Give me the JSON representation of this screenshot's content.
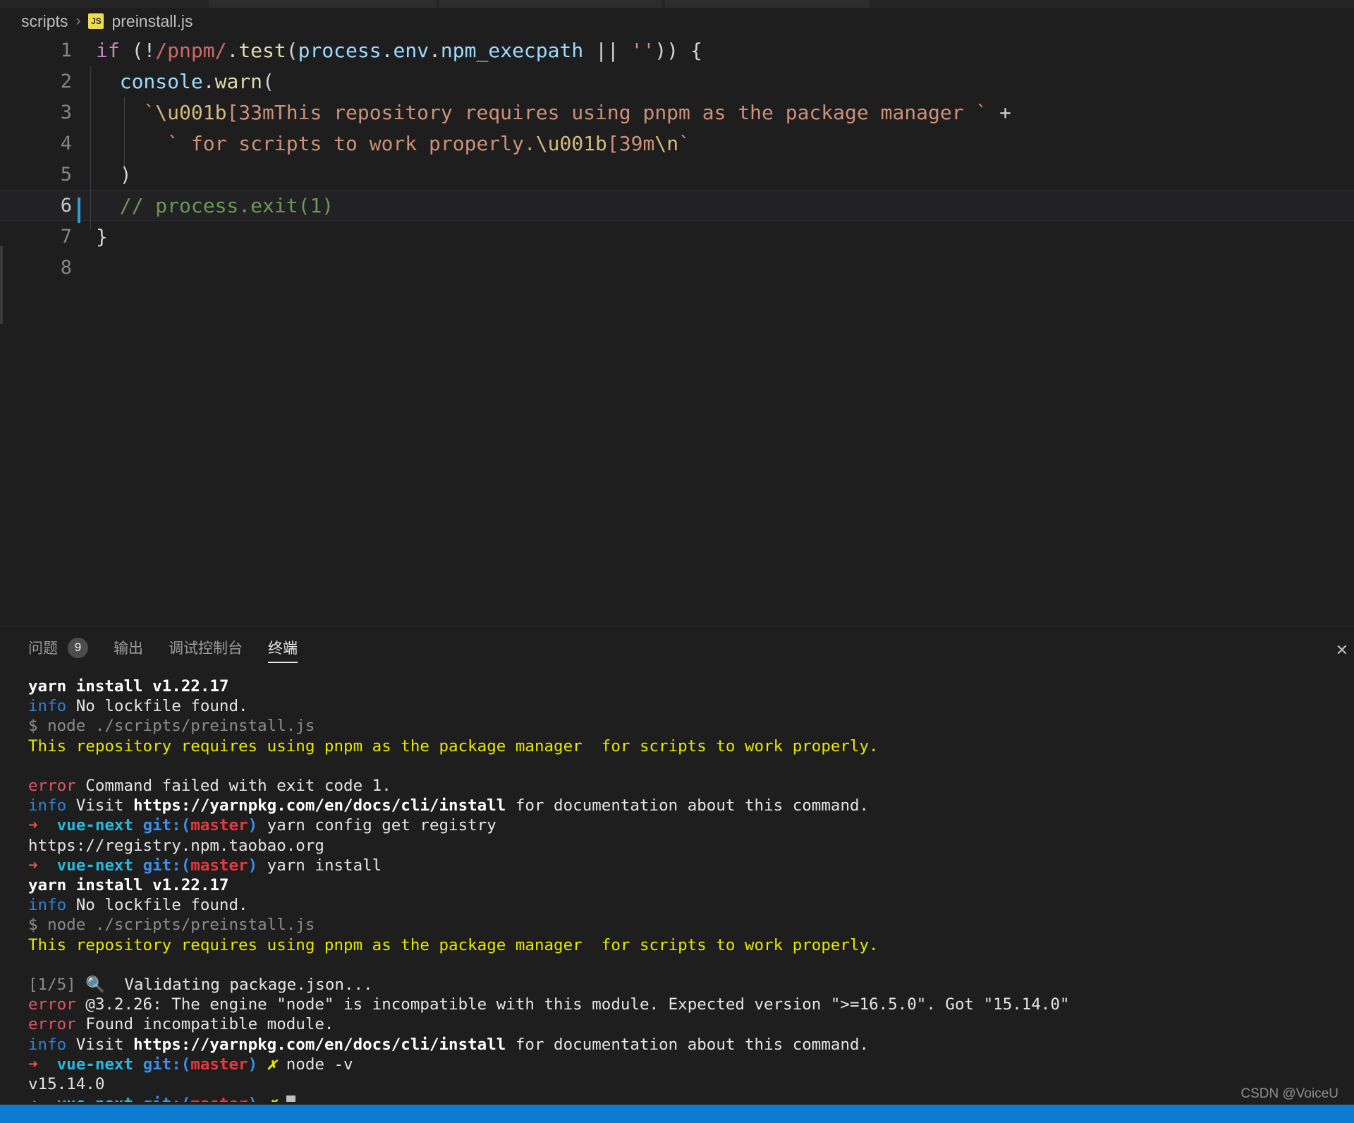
{
  "breadcrumb": {
    "folder": "scripts",
    "separator": "›",
    "file_icon": "JS",
    "file": "preinstall.js"
  },
  "editor": {
    "lines": [
      {
        "num": "1",
        "tokens": [
          {
            "t": "kw",
            "v": "if"
          },
          {
            "t": "op",
            "v": " ("
          },
          {
            "t": "op",
            "v": "!"
          },
          {
            "t": "re",
            "v": "/pnpm/"
          },
          {
            "t": "punc",
            "v": "."
          },
          {
            "t": "fn",
            "v": "test"
          },
          {
            "t": "punc",
            "v": "("
          },
          {
            "t": "var",
            "v": "process"
          },
          {
            "t": "punc",
            "v": "."
          },
          {
            "t": "var",
            "v": "env"
          },
          {
            "t": "punc",
            "v": "."
          },
          {
            "t": "var",
            "v": "npm_execpath"
          },
          {
            "t": "op",
            "v": " || "
          },
          {
            "t": "str",
            "v": "''"
          },
          {
            "t": "punc",
            "v": ")) {"
          }
        ]
      },
      {
        "num": "2",
        "tokens": [
          {
            "t": "sp",
            "v": "  "
          },
          {
            "t": "var",
            "v": "console"
          },
          {
            "t": "punc",
            "v": "."
          },
          {
            "t": "fn",
            "v": "warn"
          },
          {
            "t": "punc",
            "v": "("
          }
        ]
      },
      {
        "num": "3",
        "tokens": [
          {
            "t": "sp",
            "v": "    "
          },
          {
            "t": "str",
            "v": "`"
          },
          {
            "t": "esc",
            "v": "\\u001b"
          },
          {
            "t": "str",
            "v": "[33mThis repository requires using pnpm as the package manager `"
          },
          {
            "t": "op",
            "v": " +"
          }
        ]
      },
      {
        "num": "4",
        "tokens": [
          {
            "t": "sp",
            "v": "      "
          },
          {
            "t": "str",
            "v": "` for scripts to work properly."
          },
          {
            "t": "esc",
            "v": "\\u001b"
          },
          {
            "t": "str",
            "v": "[39m"
          },
          {
            "t": "esc",
            "v": "\\n"
          },
          {
            "t": "str",
            "v": "`"
          }
        ]
      },
      {
        "num": "5",
        "tokens": [
          {
            "t": "sp",
            "v": "  "
          },
          {
            "t": "punc",
            "v": ")"
          }
        ]
      },
      {
        "num": "6",
        "tokens": [
          {
            "t": "sp",
            "v": "  "
          },
          {
            "t": "com",
            "v": "// process.exit(1)"
          }
        ]
      },
      {
        "num": "7",
        "tokens": [
          {
            "t": "punc",
            "v": "}"
          }
        ]
      },
      {
        "num": "8",
        "tokens": []
      }
    ],
    "cursor_line": 6
  },
  "panel": {
    "tabs": [
      {
        "label": "问题",
        "badge": "9",
        "active": false
      },
      {
        "label": "输出",
        "badge": "",
        "active": false
      },
      {
        "label": "调试控制台",
        "badge": "",
        "active": false
      },
      {
        "label": "终端",
        "badge": "",
        "active": true
      }
    ],
    "close_icon": "✕"
  },
  "terminal": {
    "lines": [
      [
        {
          "c": "bold",
          "v": "yarn install v1.22.17"
        }
      ],
      [
        {
          "c": "blue",
          "v": "info"
        },
        {
          "c": "white",
          "v": " No lockfile found."
        }
      ],
      [
        {
          "c": "gray",
          "v": "$ node ./scripts/preinstall.js"
        }
      ],
      [
        {
          "c": "yellow",
          "v": "This repository requires using pnpm as the package manager  for scripts to work properly."
        }
      ],
      [
        {
          "c": "white",
          "v": ""
        }
      ],
      [
        {
          "c": "red",
          "v": "error"
        },
        {
          "c": "white",
          "v": " Command failed with exit code 1."
        }
      ],
      [
        {
          "c": "blue",
          "v": "info"
        },
        {
          "c": "white",
          "v": " Visit "
        },
        {
          "c": "bold",
          "v": "https://yarnpkg.com/en/docs/cli/install"
        },
        {
          "c": "white",
          "v": " for documentation about this command."
        }
      ],
      [
        {
          "c": "orange",
          "v": "➜"
        },
        {
          "c": "white",
          "v": "  "
        },
        {
          "c": "cyan-b",
          "v": "vue-next"
        },
        {
          "c": "white",
          "v": " "
        },
        {
          "c": "blue-b",
          "v": "git:"
        },
        {
          "c": "blue-b",
          "v": "("
        },
        {
          "c": "red-b",
          "v": "master"
        },
        {
          "c": "blue-b",
          "v": ")"
        },
        {
          "c": "white",
          "v": " yarn config get registry"
        }
      ],
      [
        {
          "c": "white",
          "v": "https://registry.npm.taobao.org"
        }
      ],
      [
        {
          "c": "orange",
          "v": "➜"
        },
        {
          "c": "white",
          "v": "  "
        },
        {
          "c": "cyan-b",
          "v": "vue-next"
        },
        {
          "c": "white",
          "v": " "
        },
        {
          "c": "blue-b",
          "v": "git:"
        },
        {
          "c": "blue-b",
          "v": "("
        },
        {
          "c": "red-b",
          "v": "master"
        },
        {
          "c": "blue-b",
          "v": ")"
        },
        {
          "c": "white",
          "v": " yarn install"
        }
      ],
      [
        {
          "c": "bold",
          "v": "yarn install v1.22.17"
        }
      ],
      [
        {
          "c": "blue",
          "v": "info"
        },
        {
          "c": "white",
          "v": " No lockfile found."
        }
      ],
      [
        {
          "c": "gray",
          "v": "$ node ./scripts/preinstall.js"
        }
      ],
      [
        {
          "c": "yellow",
          "v": "This repository requires using pnpm as the package manager  for scripts to work properly."
        }
      ],
      [
        {
          "c": "white",
          "v": ""
        }
      ],
      [
        {
          "c": "gray",
          "v": "[1/5]"
        },
        {
          "c": "white",
          "v": " 🔍  Validating package.json..."
        }
      ],
      [
        {
          "c": "red",
          "v": "error"
        },
        {
          "c": "white",
          "v": " @3.2.26: The engine \"node\" is incompatible with this module. Expected version \">=16.5.0\". Got \"15.14.0\""
        }
      ],
      [
        {
          "c": "red",
          "v": "error"
        },
        {
          "c": "white",
          "v": " Found incompatible module."
        }
      ],
      [
        {
          "c": "blue",
          "v": "info"
        },
        {
          "c": "white",
          "v": " Visit "
        },
        {
          "c": "bold",
          "v": "https://yarnpkg.com/en/docs/cli/install"
        },
        {
          "c": "white",
          "v": " for documentation about this command."
        }
      ],
      [
        {
          "c": "orange",
          "v": "➜"
        },
        {
          "c": "white",
          "v": "  "
        },
        {
          "c": "cyan-b",
          "v": "vue-next"
        },
        {
          "c": "white",
          "v": " "
        },
        {
          "c": "blue-b",
          "v": "git:"
        },
        {
          "c": "blue-b",
          "v": "("
        },
        {
          "c": "red-b",
          "v": "master"
        },
        {
          "c": "blue-b",
          "v": ")"
        },
        {
          "c": "white",
          "v": " "
        },
        {
          "c": "yel-i",
          "v": "✗"
        },
        {
          "c": "white",
          "v": " node -v"
        }
      ],
      [
        {
          "c": "white",
          "v": "v15.14.0"
        }
      ],
      [
        {
          "c": "green",
          "v": "➜"
        },
        {
          "c": "white",
          "v": "  "
        },
        {
          "c": "cyan-b",
          "v": "vue-next"
        },
        {
          "c": "white",
          "v": " "
        },
        {
          "c": "blue-b",
          "v": "git:"
        },
        {
          "c": "blue-b",
          "v": "("
        },
        {
          "c": "red-b",
          "v": "master"
        },
        {
          "c": "blue-b",
          "v": ")"
        },
        {
          "c": "white",
          "v": " "
        },
        {
          "c": "yel-i",
          "v": "✗"
        },
        {
          "c": "white",
          "v": " "
        },
        {
          "c": "cursor",
          "v": ""
        }
      ]
    ]
  },
  "watermark": "CSDN @VoiceU",
  "colors": {
    "editor_bg": "#1e1e1e",
    "statusbar": "#0c7bd0",
    "js_badge": "#f0db4f",
    "accent": "#3b8eea"
  }
}
